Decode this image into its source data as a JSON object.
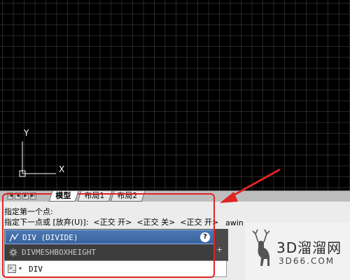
{
  "layout_tabs": {
    "items": [
      {
        "label": "模型"
      },
      {
        "label": "布局1"
      },
      {
        "label": "布局2"
      }
    ],
    "nav_glyphs": [
      "|◀",
      "◀",
      "▶",
      "▶|"
    ]
  },
  "ucs": {
    "y_label": "Y",
    "x_label": "X"
  },
  "command_history": {
    "lines": [
      "指定第一个点:",
      "指定下一点或 [放弃(U)]:  <正交 开>  <正交 关>  <正交 开>"
    ],
    "overflow_text": "awin"
  },
  "autocomplete": {
    "suggestions": [
      {
        "label": "DIV (DIVIDE)",
        "icon": "divide-icon"
      },
      {
        "label": "DIVMESHBOXHEIGHT",
        "icon": "settings-icon"
      }
    ],
    "help_glyph": "?",
    "globe_icon": "globe-icon",
    "plus_glyph": "+"
  },
  "command_line": {
    "value": "DIV",
    "icon": "command-prompt-icon",
    "dropdown_glyph": "▾"
  },
  "watermark": {
    "brand": "3D溜溜网",
    "url": "3D66.COM"
  },
  "colors": {
    "annotation": "#e02424",
    "selected": "#3a63a0",
    "canvas": "#000000"
  }
}
